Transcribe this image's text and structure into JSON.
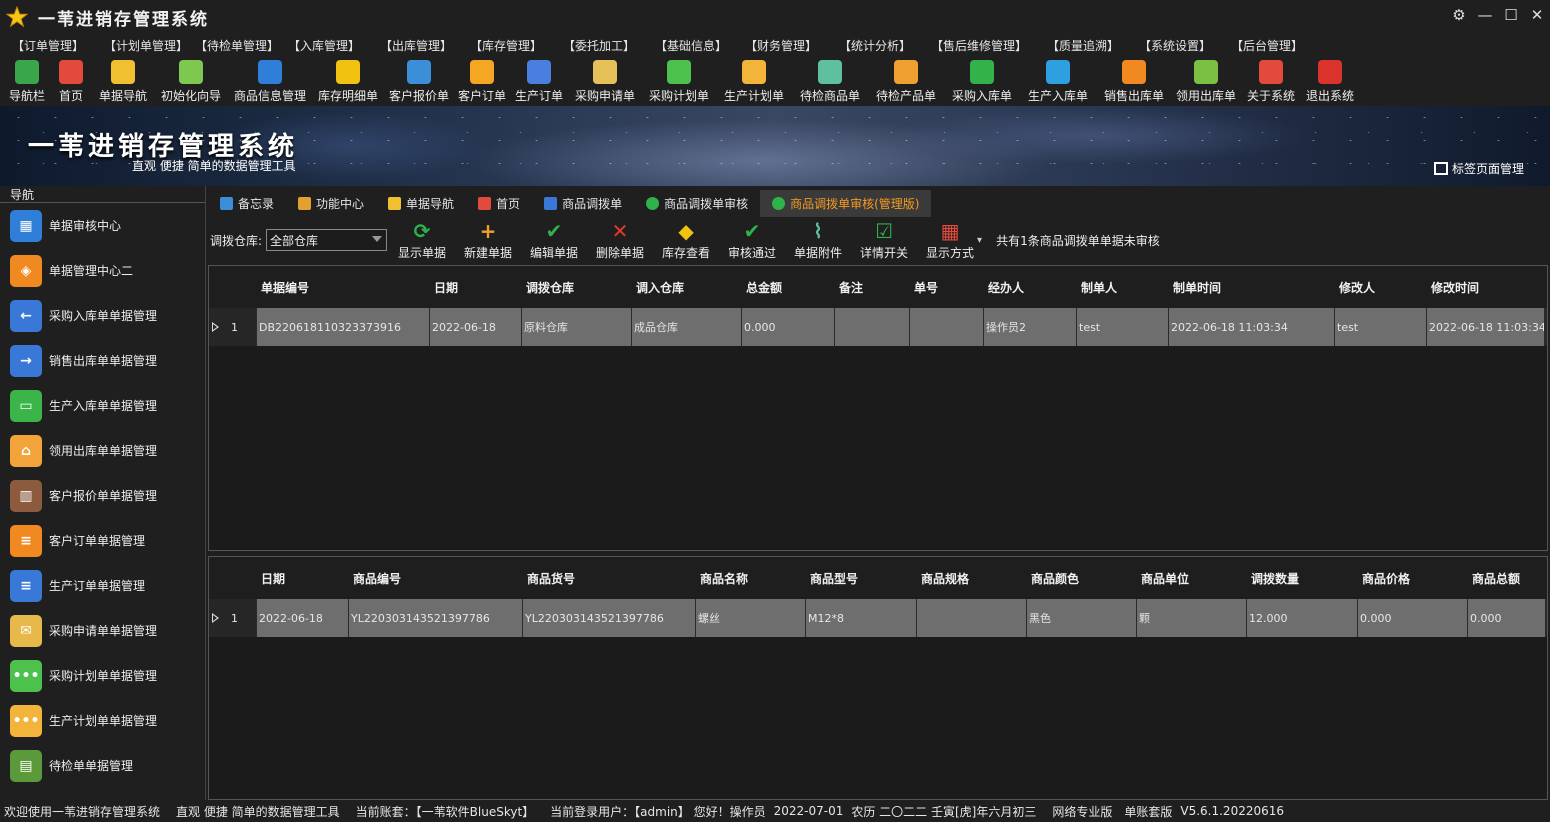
{
  "app": {
    "title": "一苇进销存管理系统"
  },
  "menubar": [
    "【订单管理】",
    "【计划单管理】",
    "【待检单管理】",
    "【入库管理】",
    "【出库管理】",
    "【库存管理】",
    "【委托加工】",
    "【基础信息】",
    "【财务管理】",
    "【统计分析】",
    "【售后维修管理】",
    "【质量追溯】",
    "【系统设置】",
    "【后台管理】"
  ],
  "toolbar": [
    {
      "label": "导航栏",
      "icon": "menu-lines-icon",
      "color": "#3aa64a"
    },
    {
      "label": "首页",
      "icon": "home-icon",
      "color": "#e24a3b"
    },
    {
      "label": "单据导航",
      "icon": "compass-icon",
      "color": "#f0c030"
    },
    {
      "label": "初始化向导",
      "icon": "magic-wand-icon",
      "color": "#7ec850"
    },
    {
      "label": "商品信息管理",
      "icon": "cubes-icon",
      "color": "#2f7fd8"
    },
    {
      "label": "库存明细单",
      "icon": "warning-icon",
      "color": "#f2c211"
    },
    {
      "label": "客户报价单",
      "icon": "price-tag-icon",
      "color": "#3a8fd8"
    },
    {
      "label": "客户订单",
      "icon": "doc-orange-icon",
      "color": "#f5a623"
    },
    {
      "label": "生产订单",
      "icon": "doc-blue-icon",
      "color": "#4a7fe0"
    },
    {
      "label": "采购申请单",
      "icon": "envelope-icon",
      "color": "#e6c15a"
    },
    {
      "label": "采购计划单",
      "icon": "chat-green-icon",
      "color": "#4cc14c"
    },
    {
      "label": "生产计划单",
      "icon": "chat-yellow-icon",
      "color": "#f2b43a"
    },
    {
      "label": "待检商品单",
      "icon": "flask-icon",
      "color": "#5fc0a0"
    },
    {
      "label": "待检产品单",
      "icon": "beaker-icon",
      "color": "#f0a030"
    },
    {
      "label": "采购入库单",
      "icon": "plus-circle-icon",
      "color": "#33b24a"
    },
    {
      "label": "生产入库单",
      "icon": "cart-icon",
      "color": "#2f9fe0"
    },
    {
      "label": "销售出库单",
      "icon": "box-out-icon",
      "color": "#f08a20"
    },
    {
      "label": "领用出库单",
      "icon": "download-icon",
      "color": "#7bc043"
    },
    {
      "label": "关于系统",
      "icon": "home-red-icon",
      "color": "#e24a3b"
    },
    {
      "label": "退出系统",
      "icon": "exit-icon",
      "color": "#d9332b"
    }
  ],
  "banner": {
    "title": "一苇进销存管理系统",
    "subtitle": "直观 便捷 简单的数据管理工具",
    "tag_manager": "标签页面管理"
  },
  "nav": {
    "title": "导航",
    "items": [
      {
        "label": "单据审核中心",
        "color": "#2f7fd8",
        "glyph": "▦"
      },
      {
        "label": "单据管理中心二",
        "color": "#f08a20",
        "glyph": "◈"
      },
      {
        "label": "采购入库单单据管理",
        "color": "#3a78d8",
        "glyph": "←"
      },
      {
        "label": "销售出库单单据管理",
        "color": "#3a78d8",
        "glyph": "→"
      },
      {
        "label": "生产入库单单据管理",
        "color": "#3bb54a",
        "glyph": "▭"
      },
      {
        "label": "领用出库单单据管理",
        "color": "#f2a43a",
        "glyph": "⌂"
      },
      {
        "label": "客户报价单单据管理",
        "color": "#8c5a3c",
        "glyph": "▥"
      },
      {
        "label": "客户订单单据管理",
        "color": "#f08a20",
        "glyph": "≡"
      },
      {
        "label": "生产订单单据管理",
        "color": "#3a78d8",
        "glyph": "≡"
      },
      {
        "label": "采购申请单单据管理",
        "color": "#e6b94a",
        "glyph": "✉"
      },
      {
        "label": "采购计划单单据管理",
        "color": "#4cc14c",
        "glyph": "•••"
      },
      {
        "label": "生产计划单单据管理",
        "color": "#f2b43a",
        "glyph": "•••"
      },
      {
        "label": "待检单单据管理",
        "color": "#5a9a3a",
        "glyph": "▤"
      }
    ]
  },
  "tabs": [
    {
      "label": "备忘录",
      "color": "#3a8fd8",
      "active": false
    },
    {
      "label": "功能中心",
      "color": "#e2a030",
      "active": false
    },
    {
      "label": "单据导航",
      "color": "#f0c030",
      "active": false
    },
    {
      "label": "首页",
      "color": "#e24a3b",
      "active": false
    },
    {
      "label": "商品调拨单",
      "color": "#3a78d8",
      "active": false
    },
    {
      "label": "商品调拨单审核",
      "color": "#2fb24a",
      "active": false
    },
    {
      "label": "商品调拨单审核(管理版)",
      "color": "#2fb24a",
      "active": true
    }
  ],
  "filter": {
    "warehouse_label": "调拨仓库:",
    "warehouse_value": "全部仓库"
  },
  "actions": [
    {
      "label": "显示单据",
      "icon": "refresh-icon",
      "color": "#2fb24a",
      "glyph": "⟳"
    },
    {
      "label": "新建单据",
      "icon": "plus-icon",
      "color": "#f0a030",
      "glyph": "+"
    },
    {
      "label": "编辑单据",
      "icon": "check-icon",
      "color": "#2fb24a",
      "glyph": "✔"
    },
    {
      "label": "删除单据",
      "icon": "cross-icon",
      "color": "#e23a2b",
      "glyph": "✕"
    },
    {
      "label": "库存查看",
      "icon": "box-icon",
      "color": "#f2c211",
      "glyph": "◆"
    },
    {
      "label": "审核通过",
      "icon": "approve-icon",
      "color": "#2fb24a",
      "glyph": "✔"
    },
    {
      "label": "单据附件",
      "icon": "paperclip-icon",
      "color": "#5fc0a0",
      "glyph": "⌇"
    },
    {
      "label": "详情开关",
      "icon": "checklist-icon",
      "color": "#2fb24a",
      "glyph": "☑"
    },
    {
      "label": "显示方式",
      "icon": "grid-icon",
      "color": "#e24a3b",
      "glyph": "▦"
    }
  ],
  "message": "共有1条商品调拨单单据未审核",
  "master_grid": {
    "columns": [
      "单据编号",
      "日期",
      "调拨仓库",
      "调入仓库",
      "总金额",
      "备注",
      "单号",
      "经办人",
      "制单人",
      "制单时间",
      "修改人",
      "修改时间"
    ],
    "rows": [
      {
        "index": "1",
        "cells": [
          "DB220618110323373916",
          "2022-06-18",
          "原料仓库",
          "成品仓库",
          "0.000",
          "",
          "",
          "操作员2",
          "test",
          "2022-06-18 11:03:34",
          "test",
          "2022-06-18 11:03:34"
        ]
      }
    ]
  },
  "detail_grid": {
    "columns": [
      "日期",
      "商品编号",
      "商品货号",
      "商品名称",
      "商品型号",
      "商品规格",
      "商品颜色",
      "商品单位",
      "调拨数量",
      "商品价格",
      "商品总额"
    ],
    "rows": [
      {
        "index": "1",
        "cells": [
          "2022-06-18",
          "YL220303143521397786",
          "YL220303143521397786",
          "螺丝",
          "M12*8",
          "",
          "黑色",
          "颗",
          "12.000",
          "0.000",
          "0.000"
        ]
      }
    ]
  },
  "status": {
    "welcome": "欢迎使用一苇进销存管理系统",
    "slogan": "直观 便捷 简单的数据管理工具",
    "account": "当前账套：【一苇软件BlueSkyt】",
    "user": "当前登录用户：【admin】 您好！操作员",
    "date": "2022-07-01",
    "lunar": "农历 二〇二二 壬寅[虎]年六月初三",
    "edition": "网络专业版",
    "mode": "单账套版",
    "version": "V5.6.1.20220616"
  }
}
